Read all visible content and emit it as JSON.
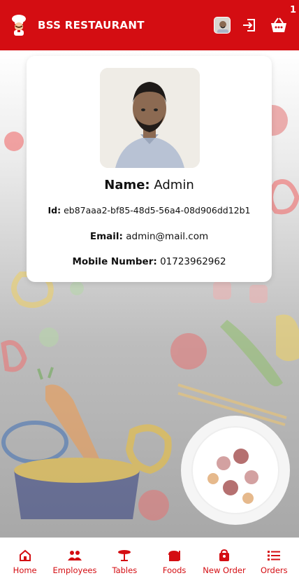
{
  "app": {
    "title": "BSS RESTAURANT",
    "cart_count": "1"
  },
  "profile": {
    "name_label": "Name:",
    "name_value": "Admin",
    "id_label": "Id:",
    "id_value": "eb87aaa2-bf85-48d5-56a4-08d906dd12b1",
    "email_label": "Email:",
    "email_value": "admin@mail.com",
    "mobile_label": "Mobile Number:",
    "mobile_value": "01723962962"
  },
  "nav": [
    {
      "label": "Home",
      "icon": "home-icon"
    },
    {
      "label": "Employees",
      "icon": "people-icon"
    },
    {
      "label": "Tables",
      "icon": "table-icon"
    },
    {
      "label": "Foods",
      "icon": "food-icon"
    },
    {
      "label": "New Order",
      "icon": "bag-icon"
    },
    {
      "label": "Orders",
      "icon": "list-icon"
    }
  ],
  "colors": {
    "primary": "#d40d12",
    "background": "#ffffff"
  }
}
